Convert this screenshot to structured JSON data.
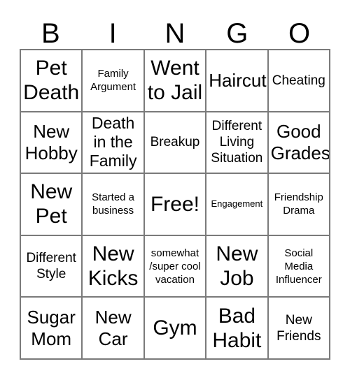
{
  "card": {
    "header_letters": [
      "B",
      "I",
      "N",
      "G",
      "O"
    ],
    "rows": [
      [
        {
          "text": "Pet Death",
          "size": "t-xxl"
        },
        {
          "text": "Family Argument",
          "size": "t-sm"
        },
        {
          "text": "Went to Jail",
          "size": "t-xxl"
        },
        {
          "text": "Haircut",
          "size": "t-xl"
        },
        {
          "text": "Cheating",
          "size": "t-md"
        }
      ],
      [
        {
          "text": "New Hobby",
          "size": "t-xl"
        },
        {
          "text": "Death in the Family",
          "size": "t-lg"
        },
        {
          "text": "Breakup",
          "size": "t-md"
        },
        {
          "text": "Different Living Situation",
          "size": "t-md"
        },
        {
          "text": "Good Grades",
          "size": "t-xl"
        }
      ],
      [
        {
          "text": "New Pet",
          "size": "t-xxl"
        },
        {
          "text": "Started a business",
          "size": "t-sm"
        },
        {
          "text": "Free!",
          "size": "t-xxl"
        },
        {
          "text": "Engagement",
          "size": "t-xs"
        },
        {
          "text": "Friendship Drama",
          "size": "t-sm"
        }
      ],
      [
        {
          "text": "Different Style",
          "size": "t-md"
        },
        {
          "text": "New Kicks",
          "size": "t-xxl"
        },
        {
          "text": "somewhat /super cool vacation",
          "size": "t-sm"
        },
        {
          "text": "New Job",
          "size": "t-xxl"
        },
        {
          "text": "Social Media Influencer",
          "size": "t-sm"
        }
      ],
      [
        {
          "text": "Sugar Mom",
          "size": "t-xl"
        },
        {
          "text": "New Car",
          "size": "t-xl"
        },
        {
          "text": "Gym",
          "size": "t-xxl"
        },
        {
          "text": "Bad Habit",
          "size": "t-xxl"
        },
        {
          "text": "New Friends",
          "size": "t-md"
        }
      ]
    ]
  },
  "colors": {
    "background": "#ffffff",
    "text": "#000000",
    "grid_line": "#7a7a7a"
  }
}
